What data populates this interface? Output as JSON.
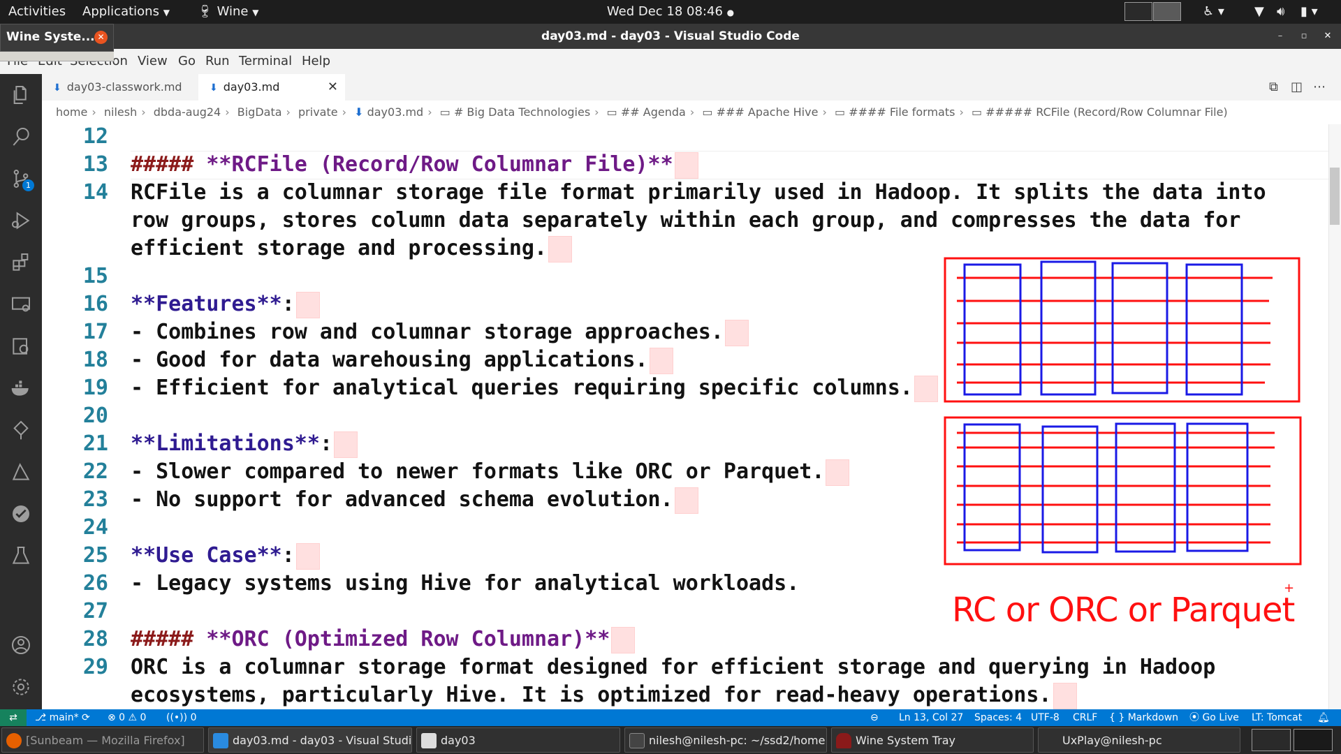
{
  "topbar": {
    "activities": "Activities",
    "applications": "Applications",
    "wine_menu": "Wine",
    "clock": "Wed Dec 18  08:46"
  },
  "window": {
    "title": "day03.md - day03 - Visual Studio Code",
    "wine_tooltip": "Wine Syste..."
  },
  "menu": [
    "File",
    "Edit",
    "Selection",
    "View",
    "Go",
    "Run",
    "Terminal",
    "Help"
  ],
  "tabs": [
    {
      "label": "day03-classwork.md",
      "active": false
    },
    {
      "label": "day03.md",
      "active": true
    }
  ],
  "breadcrumb": [
    "home",
    "nilesh",
    "dbda-aug24",
    "BigData",
    "private",
    "day03.md",
    "# Big Data Technologies",
    "## Agenda",
    "### Apache Hive",
    "#### File formats",
    "##### RCFile (Record/Row Columnar File)"
  ],
  "activity_badge": "1",
  "editor": {
    "lines": [
      {
        "num": "12",
        "text": ""
      },
      {
        "num": "13",
        "text": "**RCFile (Record/Row Columnar File)**",
        "prefix": "#####"
      },
      {
        "num": "14",
        "text": "RCFile is a columnar storage file format primarily used in Hadoop. It splits the data into"
      },
      {
        "num": "",
        "text": "row groups, stores column data separately within each group, and compresses the data for"
      },
      {
        "num": "",
        "text": "efficient storage and processing."
      },
      {
        "num": "15",
        "text": ""
      },
      {
        "num": "16",
        "text": "**Features**",
        "suffix": ":"
      },
      {
        "num": "17",
        "text": "- Combines row and columnar storage approaches."
      },
      {
        "num": "18",
        "text": "- Good for data warehousing applications."
      },
      {
        "num": "19",
        "text": "- Efficient for analytical queries requiring specific columns."
      },
      {
        "num": "20",
        "text": ""
      },
      {
        "num": "21",
        "text": "**Limitations**",
        "suffix": ":"
      },
      {
        "num": "22",
        "text": "- Slower compared to newer formats like ORC or Parquet."
      },
      {
        "num": "23",
        "text": "- No support for advanced schema evolution."
      },
      {
        "num": "24",
        "text": ""
      },
      {
        "num": "25",
        "text": "**Use Case**",
        "suffix": ":"
      },
      {
        "num": "26",
        "text": "- Legacy systems using Hive for analytical workloads."
      },
      {
        "num": "27",
        "text": ""
      },
      {
        "num": "28",
        "text": "**ORC (Optimized Row Columnar)**",
        "prefix": "#####"
      },
      {
        "num": "29",
        "text": "ORC is a columnar storage format designed for efficient storage and querying in Hadoop"
      },
      {
        "num": "",
        "text": "ecosystems, particularly Hive. It is optimized for read-heavy operations."
      }
    ]
  },
  "drawing": {
    "caption": "RC or ORC or Parquet",
    "colors": {
      "frame": "#ff1010",
      "rows": "#ff1010",
      "columns": "#1a1ae6"
    }
  },
  "statusbar": {
    "branch": "main*",
    "problems": "⊗ 0 ⚠ 0",
    "ports": "0",
    "position": "Ln 13, Col 27",
    "spaces": "Spaces: 4",
    "encoding": "UTF-8",
    "eol": "CRLF",
    "language": "{ } Markdown",
    "golive": "Go Live",
    "tomcat": "LT: Tomcat"
  },
  "taskbar": [
    {
      "label": "[Sunbeam — Mozilla Firefox]",
      "color": "#e66000"
    },
    {
      "label": "day03.md - day03 - Visual Studi...",
      "color": "#2a8be0"
    },
    {
      "label": "day03",
      "color": "#dddddd"
    },
    {
      "label": "nilesh@nilesh-pc: ~/ssd2/home...",
      "color": "#444444"
    },
    {
      "label": "Wine System Tray",
      "color": "#8a1a1a"
    },
    {
      "label": "UxPlay@nilesh-pc",
      "color": "#262626"
    }
  ]
}
